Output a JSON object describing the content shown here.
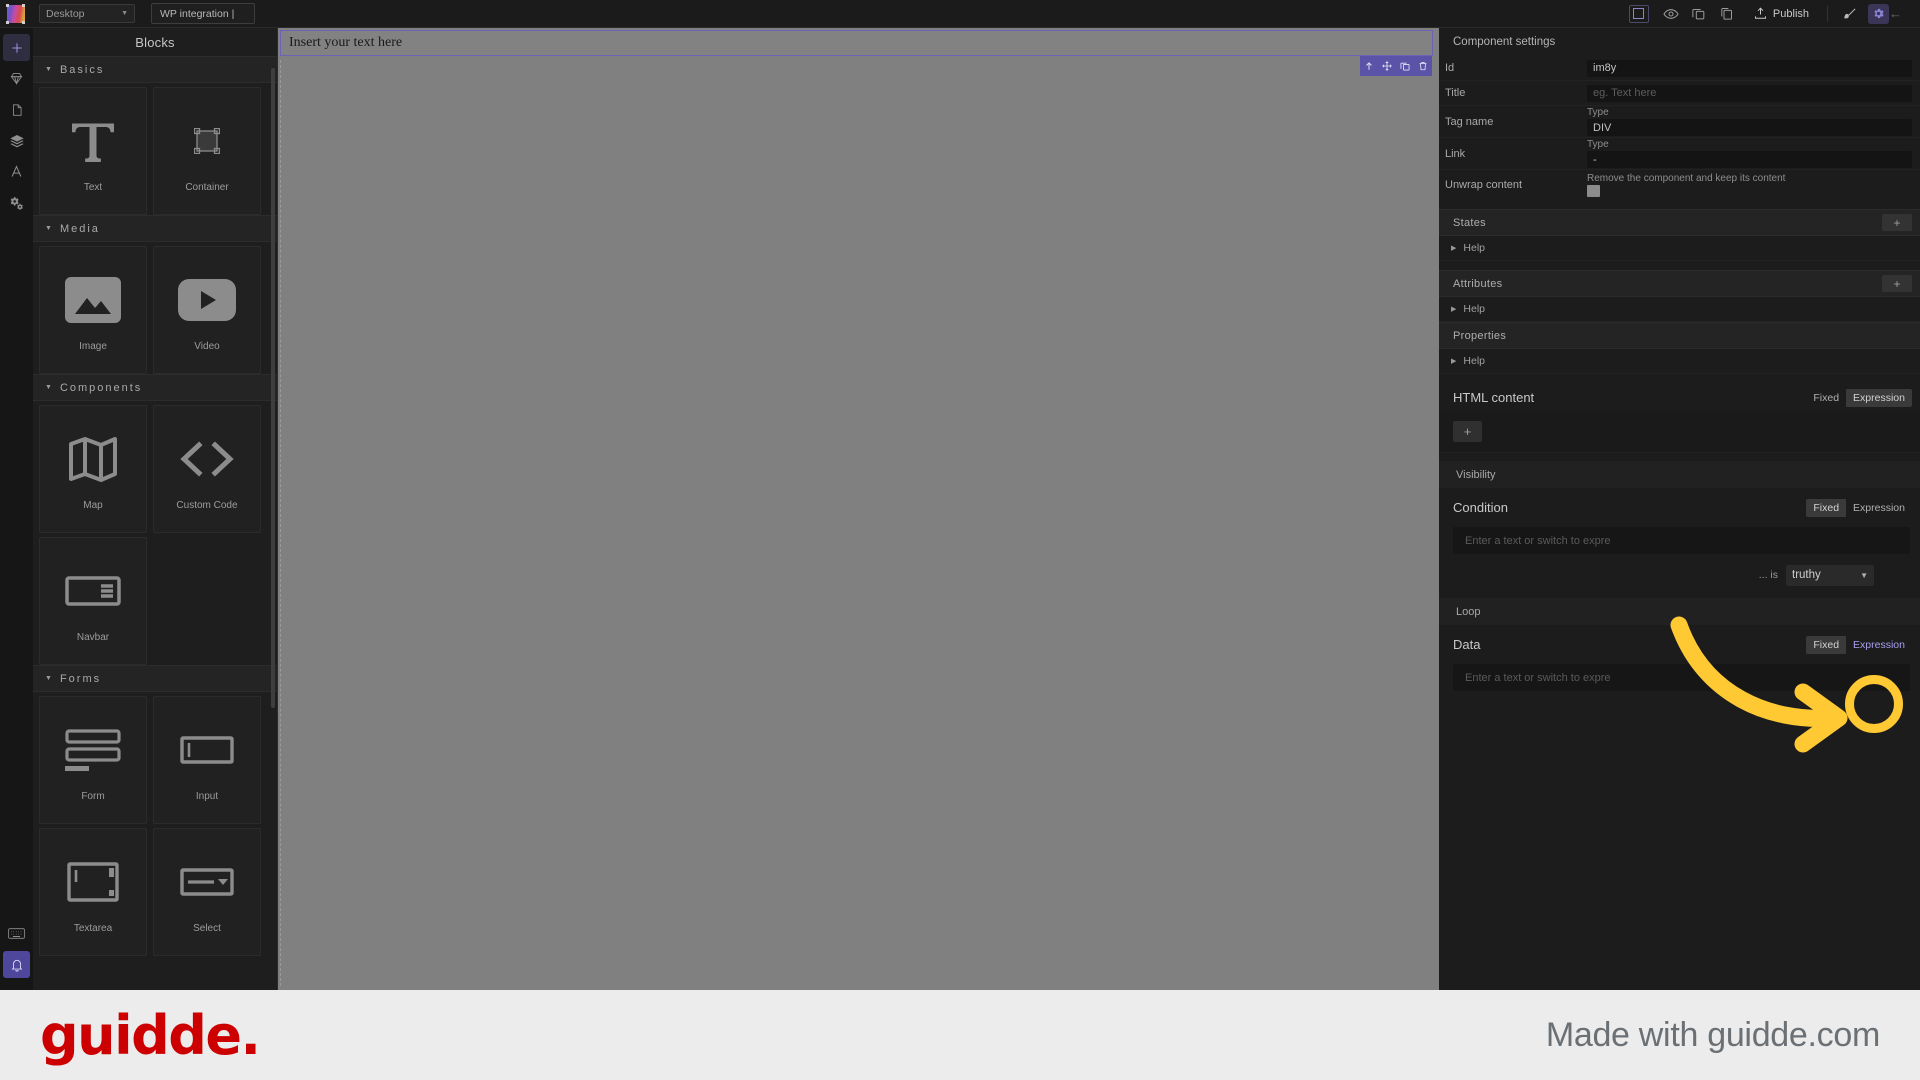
{
  "topbar": {
    "device_label": "Desktop",
    "tab_label": "WP integration |",
    "publish_label": "Publish",
    "icons": [
      "select-frame-icon",
      "eye-icon",
      "copy-icon",
      "paste-icon",
      "upload-icon",
      "brush-icon",
      "gear-icon",
      "collapse-left-icon"
    ]
  },
  "rail": {
    "items": [
      {
        "name": "add-icon",
        "glyph": "+"
      },
      {
        "name": "diamond-icon",
        "glyph": "◇"
      },
      {
        "name": "page-icon",
        "glyph": "⬚"
      },
      {
        "name": "layers-icon",
        "glyph": "≣"
      },
      {
        "name": "typography-icon",
        "glyph": "A"
      },
      {
        "name": "settings-gears-icon",
        "glyph": "⚙"
      }
    ],
    "bottom": [
      {
        "name": "keyboard-icon",
        "glyph": "⌨"
      },
      {
        "name": "notification-bell-icon",
        "glyph": "ὑ4"
      }
    ]
  },
  "blocks_panel": {
    "title": "Blocks",
    "groups": [
      {
        "name": "Basics",
        "items": [
          {
            "label": "Text",
            "icon": "text-t-icon"
          },
          {
            "label": "Container",
            "icon": "container-square-icon"
          }
        ]
      },
      {
        "name": "Media",
        "items": [
          {
            "label": "Image",
            "icon": "image-icon"
          },
          {
            "label": "Video",
            "icon": "video-play-icon"
          }
        ]
      },
      {
        "name": "Components",
        "items": [
          {
            "label": "Map",
            "icon": "map-icon"
          },
          {
            "label": "Custom Code",
            "icon": "code-brackets-icon"
          },
          {
            "label": "Navbar",
            "icon": "navbar-icon"
          }
        ]
      },
      {
        "name": "Forms",
        "items": [
          {
            "label": "Form",
            "icon": "form-icon"
          },
          {
            "label": "Input",
            "icon": "input-icon"
          },
          {
            "label": "Textarea",
            "icon": "textarea-icon"
          },
          {
            "label": "Select",
            "icon": "select-dropdown-icon"
          }
        ]
      }
    ]
  },
  "canvas": {
    "text_block": "Insert your text here",
    "element_toolbar": [
      "select-parent-arrow-icon",
      "move-icon",
      "duplicate-icon",
      "delete-trash-icon"
    ]
  },
  "settings_panel": {
    "title": "Component settings",
    "fields": [
      {
        "label": "Id",
        "value": "im8y",
        "sublabel": "",
        "placeholder": ""
      },
      {
        "label": "Title",
        "value": "",
        "sublabel": "",
        "placeholder": "eg. Text here"
      },
      {
        "label": "Tag name",
        "value": "DIV",
        "sublabel": "Type",
        "placeholder": ""
      },
      {
        "label": "Link",
        "value": "-",
        "sublabel": "Type",
        "placeholder": ""
      },
      {
        "label": "Unwrap content",
        "value": "",
        "sublabel": "Remove the component and keep its content",
        "placeholder": ""
      }
    ],
    "sections": [
      {
        "title": "States",
        "add_label": "+",
        "help_label": "Help"
      },
      {
        "title": "Attributes",
        "add_label": "+",
        "help_label": "Help"
      },
      {
        "title": "Properties",
        "add_label": "",
        "help_label": "Help"
      }
    ],
    "html_content": {
      "title": "HTML content",
      "toggle_fixed": "Fixed",
      "toggle_expression": "Expression",
      "active": "Expression",
      "add_label": "+"
    },
    "visibility": {
      "title": "Visibility",
      "condition_title": "Condition",
      "toggle_fixed": "Fixed",
      "toggle_expression": "Expression",
      "active": "Fixed",
      "condition_placeholder": "Enter a text or switch to expre",
      "is_label": "... is",
      "is_value": "truthy"
    },
    "loop": {
      "title": "Loop",
      "data_title": "Data",
      "toggle_fixed": "Fixed",
      "toggle_expression": "Expression",
      "data_placeholder": "Enter a text or switch to expre"
    }
  },
  "callout": {
    "highlight_target": "Expression",
    "accent_color": "#FFC933"
  },
  "footer": {
    "logo": "guidde.",
    "tagline": "Made with guidde.com",
    "logo_color": "#cc0000"
  }
}
